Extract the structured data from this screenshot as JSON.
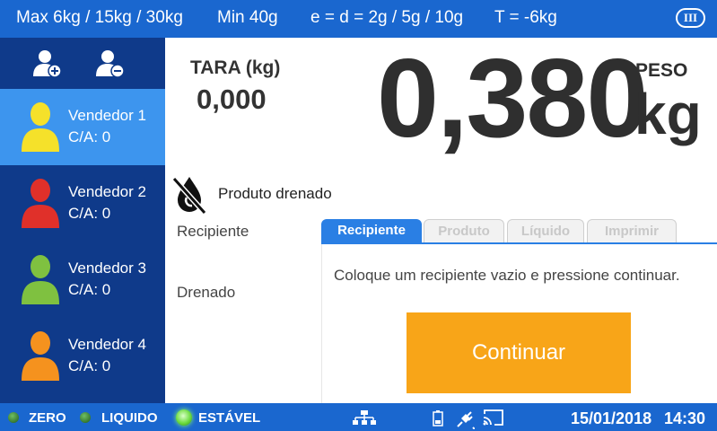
{
  "topbar": {
    "max": "Max 6kg / 15kg / 30kg",
    "min": "Min 40g",
    "e_d": "e = d = 2g / 5g / 10g",
    "tare_limit": "T = -6kg",
    "accuracy_class": "III"
  },
  "sidebar": {
    "actions": [
      {
        "icon": "add-user-icon"
      },
      {
        "icon": "remove-user-icon"
      }
    ],
    "vendors": [
      {
        "name": "Vendedor 1",
        "ca": "C/A: 0",
        "color": "#f5e12a",
        "active": true
      },
      {
        "name": "Vendedor 2",
        "ca": "C/A: 0",
        "color": "#e0302a",
        "active": false
      },
      {
        "name": "Vendedor 3",
        "ca": "C/A: 0",
        "color": "#7fc140",
        "active": false
      },
      {
        "name": "Vendedor 4",
        "ca": "C/A: 0",
        "color": "#f5921e",
        "active": false
      }
    ]
  },
  "tara": {
    "label": "TARA (kg)",
    "value": "0,000"
  },
  "weight": {
    "label": "PESO",
    "value": "0,380",
    "unit": "kg"
  },
  "mode": {
    "icon": "no-drop-icon",
    "label": "Produto drenado"
  },
  "steps": {
    "recipiente": "Recipiente",
    "drenado": "Drenado"
  },
  "tabs": [
    {
      "label": "Recipiente",
      "active": true
    },
    {
      "label": "Produto",
      "active": false
    },
    {
      "label": "Líquido",
      "active": false
    },
    {
      "label": "Imprimir",
      "active": false
    }
  ],
  "panel": {
    "instruction": "Coloque um recipiente vazio e pressione continuar.",
    "button": "Continuar"
  },
  "bottombar": {
    "indicators": [
      {
        "label": "ZERO",
        "on": false
      },
      {
        "label": "LIQUIDO",
        "on": false
      },
      {
        "label": "ESTÁVEL",
        "on": true
      }
    ],
    "icons": [
      "network-icon",
      "battery-icon",
      "power-plug-icon",
      "cast-icon"
    ],
    "date": "15/01/2018",
    "time": "14:30"
  },
  "colors": {
    "bar": "#1a67cf",
    "sidebar": "#0f3a8a",
    "active": "#3d95ee",
    "button": "#f8a518"
  }
}
